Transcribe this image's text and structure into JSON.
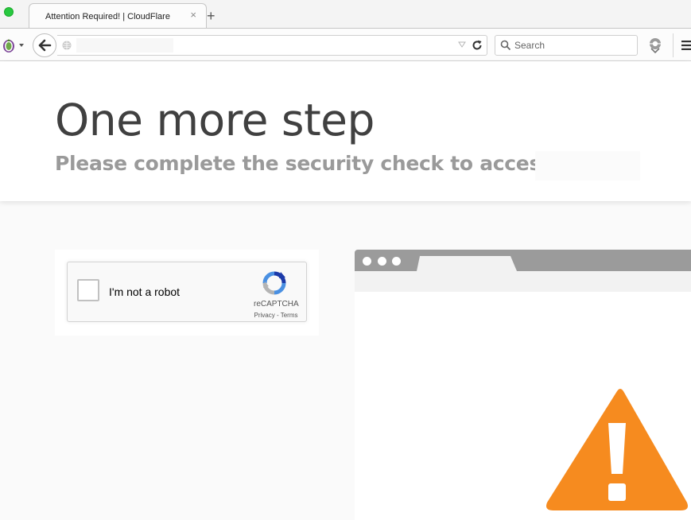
{
  "browser": {
    "tab_title": "Attention Required! | CloudFlare",
    "tab_close": "×",
    "new_tab": "+",
    "search_placeholder": "Search"
  },
  "page": {
    "headline": "One more step",
    "subheadline": "Please complete the security check to access"
  },
  "captcha": {
    "checkbox_label": "I'm not a robot",
    "checked": false,
    "brand": "reCAPTCHA",
    "privacy_link": "Privacy",
    "link_separator": " - ",
    "terms_link": "Terms"
  },
  "colors": {
    "warning": "#f68b1f",
    "recaptcha_blue": "#4a90e2",
    "recaptcha_dark": "#1c3aa9",
    "recaptcha_grey": "#b4b4b4",
    "illustration_bar": "#9b9b9b"
  },
  "icons": [
    "tor-onion-icon",
    "back-arrow-icon",
    "globe-icon",
    "dropdown-arrow-icon",
    "reload-icon",
    "search-icon",
    "extension-icon",
    "hamburger-menu-icon",
    "recaptcha-logo-icon",
    "warning-icon"
  ]
}
